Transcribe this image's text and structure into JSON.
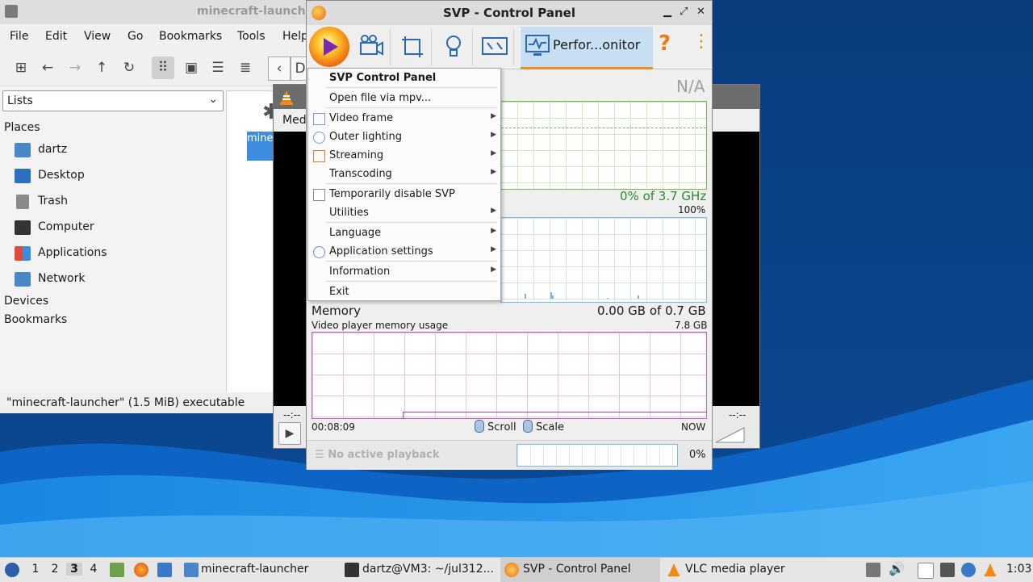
{
  "file_manager": {
    "title": "minecraft-launcher",
    "menu": [
      "File",
      "Edit",
      "View",
      "Go",
      "Bookmarks",
      "Tools",
      "Help"
    ],
    "side_pane_select": "Lists",
    "places_header": "Places",
    "places": [
      "dartz",
      "Desktop",
      "Trash",
      "Computer",
      "Applications",
      "Network"
    ],
    "devices_header": "Devices",
    "bookmarks_header": "Bookmarks",
    "path_fragment": "D",
    "file_label": "mine launc",
    "status": "\"minecraft-launcher\" (1.5 MiB) executable"
  },
  "vlc": {
    "menu_fragment": "Med",
    "time_left": "--:--",
    "time_right": "--:--"
  },
  "svp": {
    "title": "SVP - Control Panel",
    "perf_tab_label": "Perfor...onitor",
    "na_label": "N/A",
    "cpu_label": "0% of 3.7 GHz",
    "cpu_max": "100%",
    "memory_title": "Memory",
    "memory_value": "0.00 GB of 0.7 GB",
    "memory_subtitle": "Video player memory usage",
    "memory_max": "7.8 GB",
    "time_elapsed": "00:08:09",
    "scroll_label": "Scroll",
    "scale_label": "Scale",
    "now_label": "NOW",
    "no_playback": "No active playback",
    "bottom_pct": "0%"
  },
  "svp_menu": {
    "header": "SVP Control Panel",
    "items": [
      {
        "label": "Open file via mpv..."
      },
      {
        "label": "Video frame"
      },
      {
        "label": "Outer lighting"
      },
      {
        "label": "Streaming"
      },
      {
        "label": "Transcoding"
      },
      {
        "label": "Temporarily disable SVP"
      },
      {
        "label": "Utilities"
      },
      {
        "label": "Language"
      },
      {
        "label": "Application settings"
      },
      {
        "label": "Information"
      },
      {
        "label": "Exit"
      }
    ]
  },
  "taskbar": {
    "workspaces": [
      "1",
      "2",
      "3",
      "4"
    ],
    "active_workspace": "3",
    "tasks": [
      "minecraft-launcher",
      "dartz@VM3: ~/jul312...",
      "SVP - Control Panel",
      "VLC media player"
    ],
    "clock": "1:03"
  },
  "colors": {
    "accent_orange": "#f07a12",
    "cpu_green": "#2c8a2c",
    "memory_purple": "#c064b8",
    "selection_blue": "#3d8ee0"
  }
}
